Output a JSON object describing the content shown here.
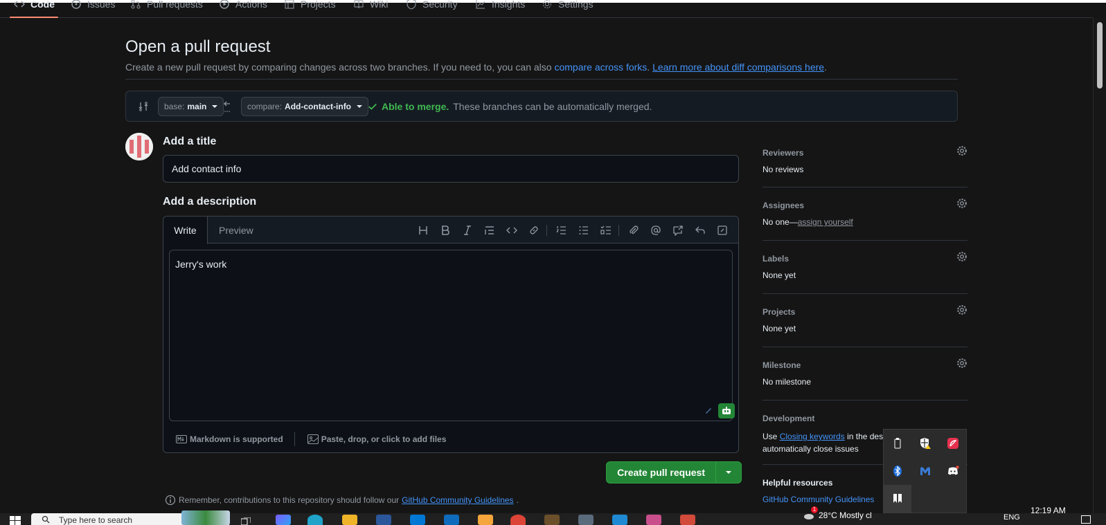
{
  "repo_nav": {
    "tabs": [
      {
        "label": "Code",
        "icon": "code-icon",
        "selected": true
      },
      {
        "label": "Issues",
        "icon": "issue-icon"
      },
      {
        "label": "Pull requests",
        "icon": "pull-request-icon"
      },
      {
        "label": "Actions",
        "icon": "play-icon"
      },
      {
        "label": "Projects",
        "icon": "table-icon"
      },
      {
        "label": "Wiki",
        "icon": "book-icon"
      },
      {
        "label": "Security",
        "icon": "shield-icon"
      },
      {
        "label": "Insights",
        "icon": "graph-icon"
      },
      {
        "label": "Settings",
        "icon": "gear-icon"
      }
    ]
  },
  "page": {
    "title": "Open a pull request",
    "subtitle_prefix": "Create a new pull request by comparing changes across two branches. If you need to, you can also ",
    "compare_forks_link": "compare across forks",
    "learn_more_link": "Learn more about diff comparisons here"
  },
  "range": {
    "base_label": "base:",
    "base_value": "main",
    "compare_label": "compare:",
    "compare_value": "Add-contact-info",
    "merge_status": "Able to merge.",
    "merge_text": "These branches can be automatically merged."
  },
  "form": {
    "title_heading": "Add a title",
    "title_value": "Add contact info",
    "description_heading": "Add a description",
    "tab_write": "Write",
    "tab_preview": "Preview",
    "description_value": "Jerry's work",
    "markdown_note": "Markdown is supported",
    "attach_note": "Paste, drop, or click to add files",
    "create_button": "Create pull request",
    "remember_text": "Remember, contributions to this repository should follow our ",
    "guidelines_link": "GitHub Community Guidelines",
    "remember_suffix": "."
  },
  "sidebar": {
    "reviewers": {
      "heading": "Reviewers",
      "value": "No reviews"
    },
    "assignees": {
      "heading": "Assignees",
      "value_prefix": "No one—",
      "link": "assign yourself"
    },
    "labels": {
      "heading": "Labels",
      "value": "None yet"
    },
    "projects": {
      "heading": "Projects",
      "value": "None yet"
    },
    "milestone": {
      "heading": "Milestone",
      "value": "No milestone"
    },
    "development": {
      "heading": "Development",
      "prefix": "Use ",
      "link": "Closing keywords",
      "suffix": " in the desc",
      "line2": "automatically close issues"
    },
    "helpful": {
      "heading": "Helpful resources",
      "link": "GitHub Community Guidelines"
    }
  },
  "taskbar": {
    "search_placeholder": "Type here to search",
    "clock": "12:19 AM",
    "weather": "28°C  Mostly cl",
    "lang": "ENG",
    "notif_badge": "1"
  },
  "colors": {
    "accent_link": "#4493f8",
    "success": "#3fb950",
    "button_green": "#238636",
    "avatar_red": "#e06c75"
  }
}
